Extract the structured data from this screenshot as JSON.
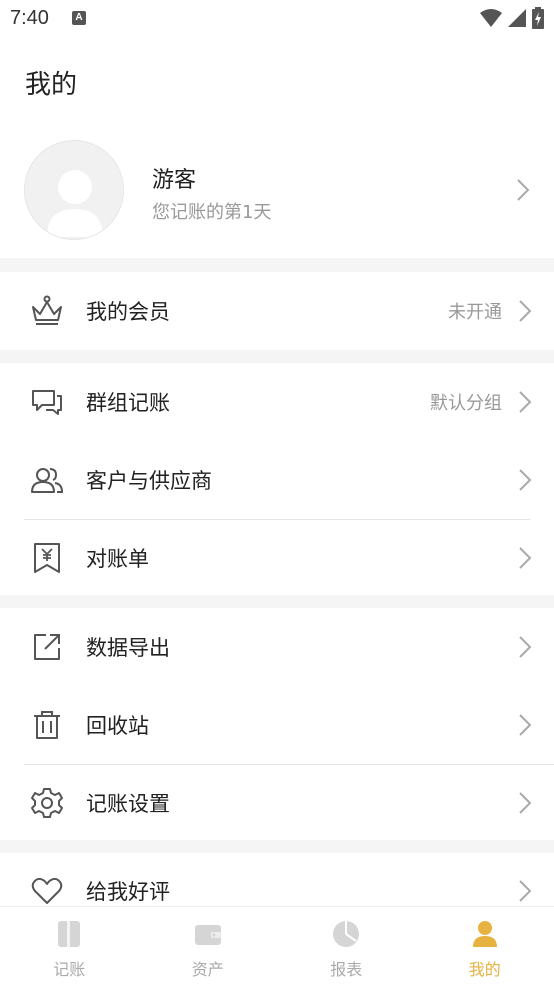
{
  "status_bar": {
    "time": "7:40",
    "app_icon_letter": "A"
  },
  "header": {
    "title": "我的"
  },
  "profile": {
    "name": "游客",
    "subtitle": "您记账的第1天"
  },
  "menu": {
    "membership": {
      "label": "我的会员",
      "value": "未开通",
      "icon": "crown-icon"
    },
    "group": {
      "label": "群组记账",
      "value": "默认分组",
      "icon": "chat-bubbles-icon"
    },
    "customers": {
      "label": "客户与供应商",
      "icon": "people-icon"
    },
    "statement": {
      "label": "对账单",
      "icon": "yen-receipt-icon"
    },
    "export": {
      "label": "数据导出",
      "icon": "export-icon"
    },
    "recycle": {
      "label": "回收站",
      "icon": "trash-icon"
    },
    "settings": {
      "label": "记账设置",
      "icon": "gear-icon"
    },
    "review": {
      "label": "给我好评",
      "icon": "heart-icon"
    }
  },
  "tabbar": {
    "tabs": [
      {
        "label": "记账",
        "icon": "book-icon"
      },
      {
        "label": "资产",
        "icon": "wallet-icon"
      },
      {
        "label": "报表",
        "icon": "pie-chart-icon"
      },
      {
        "label": "我的",
        "icon": "person-icon",
        "active": true
      }
    ]
  },
  "colors": {
    "accent": "#e7b240",
    "text": "#222222",
    "muted": "#999999",
    "background": "#f5f5f5"
  }
}
